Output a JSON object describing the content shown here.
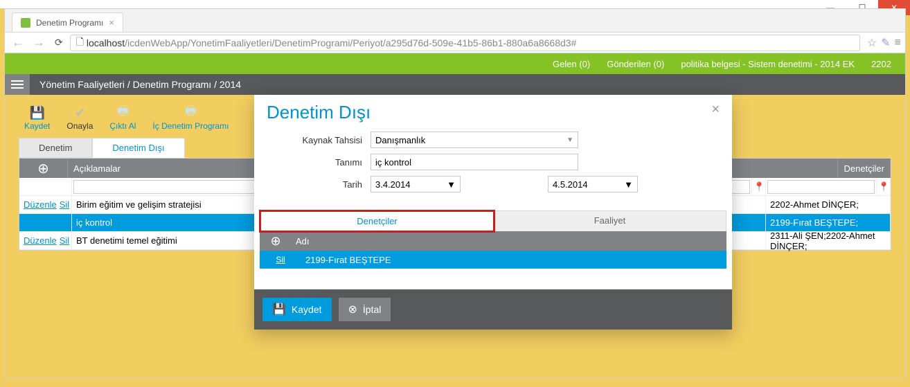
{
  "window": {
    "title": "Denetim Programı"
  },
  "browser": {
    "url_host": "localhost",
    "url_path": "/icdenWebApp/YonetimFaaliyetleri/DenetimProgrami/Periyot/a295d76d-509e-41b5-86b1-880a6a8668d3#"
  },
  "greenbar": {
    "inbox": "Gelen (0)",
    "sent": "Gönderilen (0)",
    "doc": "politika belgesi - Sistem denetimi - 2014 EK",
    "code": "2202"
  },
  "breadcrumb": "Yönetim Faaliyetleri / Denetim Programı / 2014",
  "toolbar": {
    "save": "Kaydet",
    "approve": "Onayla",
    "print": "Çıktı Al",
    "internal": "İç Denetim Programı"
  },
  "tabs": {
    "t1": "Denetim",
    "t2": "Denetim Dışı"
  },
  "grid": {
    "col_actions_add": "＋",
    "col_aciklama": "Açıklamalar",
    "col_denetciler": "Denetçiler",
    "edit": "Düzenle",
    "del": "Sil",
    "rows": [
      {
        "desc": "Birim eğitim ve gelişim stratejisi",
        "den": "2202-Ahmet DİNÇER;"
      },
      {
        "desc": "iç kontrol",
        "den": "2199-Fırat BEŞTEPE;"
      },
      {
        "desc": "BT denetimi temel eğitimi",
        "den": "2311-Ali ŞEN;2202-Ahmet DİNÇER;"
      }
    ]
  },
  "modal": {
    "title": "Denetim Dışı",
    "labels": {
      "kaynak": "Kaynak Tahsisi",
      "tanim": "Tanımı",
      "tarih": "Tarih"
    },
    "values": {
      "kaynak": "Danışmanlık",
      "tanim": "iç kontrol",
      "date1": "3.4.2014",
      "date2": "4.5.2014"
    },
    "tabs": {
      "denetciler": "Denetçiler",
      "faaliyet": "Faaliyet"
    },
    "mgrid": {
      "col_name": "Adı",
      "del": "Sil",
      "row_name": "2199-Fırat BEŞTEPE"
    },
    "buttons": {
      "save": "Kaydet",
      "cancel": "İptal"
    }
  }
}
